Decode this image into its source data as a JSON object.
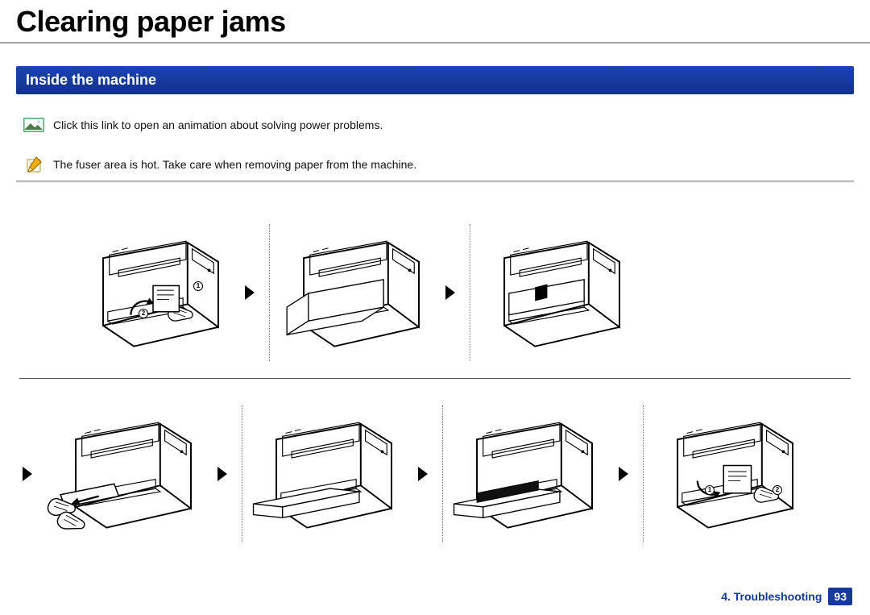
{
  "page": {
    "title": "Clearing paper jams",
    "section_heading": "Inside the machine",
    "link_row": {
      "icon": "picture-icon",
      "text": "Click this link to open an animation about solving power problems."
    },
    "note_row": {
      "icon": "pencil-note-icon",
      "text": "The fuser area is hot. Take care when removing paper from the machine."
    },
    "step_callouts": {
      "row1_first": {
        "a": "1",
        "b": "2"
      },
      "row2_last": {
        "a": "1",
        "b": "2"
      }
    },
    "footer": {
      "chapter": "4.  Troubleshooting",
      "page_number": "93"
    }
  }
}
